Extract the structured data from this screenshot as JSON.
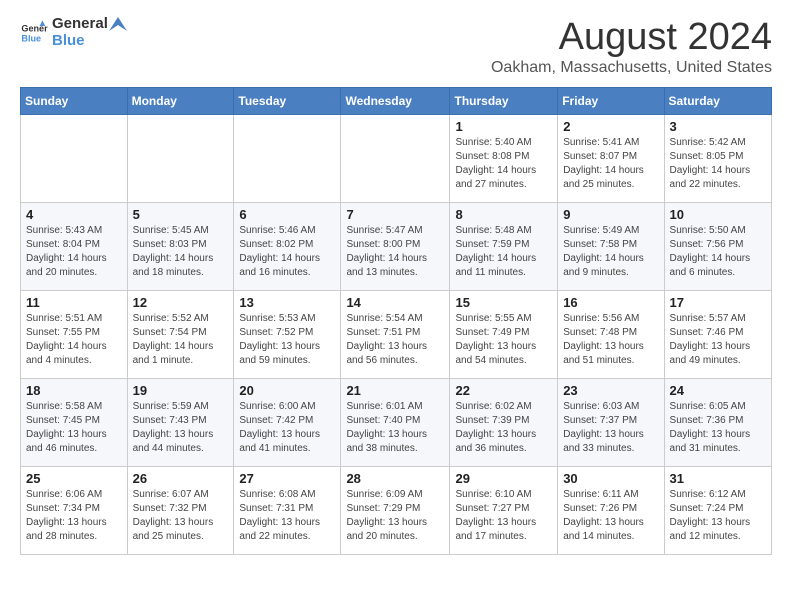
{
  "header": {
    "logo_general": "General",
    "logo_blue": "Blue",
    "title": "August 2024",
    "location": "Oakham, Massachusetts, United States"
  },
  "days_of_week": [
    "Sunday",
    "Monday",
    "Tuesday",
    "Wednesday",
    "Thursday",
    "Friday",
    "Saturday"
  ],
  "weeks": [
    [
      {
        "day": "",
        "info": ""
      },
      {
        "day": "",
        "info": ""
      },
      {
        "day": "",
        "info": ""
      },
      {
        "day": "",
        "info": ""
      },
      {
        "day": "1",
        "info": "Sunrise: 5:40 AM\nSunset: 8:08 PM\nDaylight: 14 hours\nand 27 minutes."
      },
      {
        "day": "2",
        "info": "Sunrise: 5:41 AM\nSunset: 8:07 PM\nDaylight: 14 hours\nand 25 minutes."
      },
      {
        "day": "3",
        "info": "Sunrise: 5:42 AM\nSunset: 8:05 PM\nDaylight: 14 hours\nand 22 minutes."
      }
    ],
    [
      {
        "day": "4",
        "info": "Sunrise: 5:43 AM\nSunset: 8:04 PM\nDaylight: 14 hours\nand 20 minutes."
      },
      {
        "day": "5",
        "info": "Sunrise: 5:45 AM\nSunset: 8:03 PM\nDaylight: 14 hours\nand 18 minutes."
      },
      {
        "day": "6",
        "info": "Sunrise: 5:46 AM\nSunset: 8:02 PM\nDaylight: 14 hours\nand 16 minutes."
      },
      {
        "day": "7",
        "info": "Sunrise: 5:47 AM\nSunset: 8:00 PM\nDaylight: 14 hours\nand 13 minutes."
      },
      {
        "day": "8",
        "info": "Sunrise: 5:48 AM\nSunset: 7:59 PM\nDaylight: 14 hours\nand 11 minutes."
      },
      {
        "day": "9",
        "info": "Sunrise: 5:49 AM\nSunset: 7:58 PM\nDaylight: 14 hours\nand 9 minutes."
      },
      {
        "day": "10",
        "info": "Sunrise: 5:50 AM\nSunset: 7:56 PM\nDaylight: 14 hours\nand 6 minutes."
      }
    ],
    [
      {
        "day": "11",
        "info": "Sunrise: 5:51 AM\nSunset: 7:55 PM\nDaylight: 14 hours\nand 4 minutes."
      },
      {
        "day": "12",
        "info": "Sunrise: 5:52 AM\nSunset: 7:54 PM\nDaylight: 14 hours\nand 1 minute."
      },
      {
        "day": "13",
        "info": "Sunrise: 5:53 AM\nSunset: 7:52 PM\nDaylight: 13 hours\nand 59 minutes."
      },
      {
        "day": "14",
        "info": "Sunrise: 5:54 AM\nSunset: 7:51 PM\nDaylight: 13 hours\nand 56 minutes."
      },
      {
        "day": "15",
        "info": "Sunrise: 5:55 AM\nSunset: 7:49 PM\nDaylight: 13 hours\nand 54 minutes."
      },
      {
        "day": "16",
        "info": "Sunrise: 5:56 AM\nSunset: 7:48 PM\nDaylight: 13 hours\nand 51 minutes."
      },
      {
        "day": "17",
        "info": "Sunrise: 5:57 AM\nSunset: 7:46 PM\nDaylight: 13 hours\nand 49 minutes."
      }
    ],
    [
      {
        "day": "18",
        "info": "Sunrise: 5:58 AM\nSunset: 7:45 PM\nDaylight: 13 hours\nand 46 minutes."
      },
      {
        "day": "19",
        "info": "Sunrise: 5:59 AM\nSunset: 7:43 PM\nDaylight: 13 hours\nand 44 minutes."
      },
      {
        "day": "20",
        "info": "Sunrise: 6:00 AM\nSunset: 7:42 PM\nDaylight: 13 hours\nand 41 minutes."
      },
      {
        "day": "21",
        "info": "Sunrise: 6:01 AM\nSunset: 7:40 PM\nDaylight: 13 hours\nand 38 minutes."
      },
      {
        "day": "22",
        "info": "Sunrise: 6:02 AM\nSunset: 7:39 PM\nDaylight: 13 hours\nand 36 minutes."
      },
      {
        "day": "23",
        "info": "Sunrise: 6:03 AM\nSunset: 7:37 PM\nDaylight: 13 hours\nand 33 minutes."
      },
      {
        "day": "24",
        "info": "Sunrise: 6:05 AM\nSunset: 7:36 PM\nDaylight: 13 hours\nand 31 minutes."
      }
    ],
    [
      {
        "day": "25",
        "info": "Sunrise: 6:06 AM\nSunset: 7:34 PM\nDaylight: 13 hours\nand 28 minutes."
      },
      {
        "day": "26",
        "info": "Sunrise: 6:07 AM\nSunset: 7:32 PM\nDaylight: 13 hours\nand 25 minutes."
      },
      {
        "day": "27",
        "info": "Sunrise: 6:08 AM\nSunset: 7:31 PM\nDaylight: 13 hours\nand 22 minutes."
      },
      {
        "day": "28",
        "info": "Sunrise: 6:09 AM\nSunset: 7:29 PM\nDaylight: 13 hours\nand 20 minutes."
      },
      {
        "day": "29",
        "info": "Sunrise: 6:10 AM\nSunset: 7:27 PM\nDaylight: 13 hours\nand 17 minutes."
      },
      {
        "day": "30",
        "info": "Sunrise: 6:11 AM\nSunset: 7:26 PM\nDaylight: 13 hours\nand 14 minutes."
      },
      {
        "day": "31",
        "info": "Sunrise: 6:12 AM\nSunset: 7:24 PM\nDaylight: 13 hours\nand 12 minutes."
      }
    ]
  ]
}
